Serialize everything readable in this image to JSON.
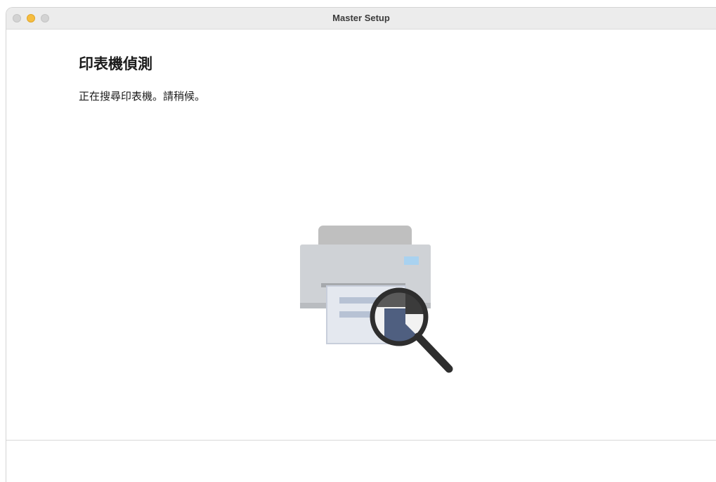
{
  "window": {
    "title": "Master Setup"
  },
  "main": {
    "heading": "印表機偵測",
    "message": "正在搜尋印表機。請稍候。"
  },
  "illustration": {
    "icon": "printer-search-icon"
  },
  "colors": {
    "minimize": "#f6bd40",
    "traffic_inactive": "#d3d3d3",
    "printer_body": "#cfd2d6",
    "printer_top": "#bdbdbd",
    "paper_lines": "#5b6b86",
    "magnifier": "#2e2e2e"
  }
}
